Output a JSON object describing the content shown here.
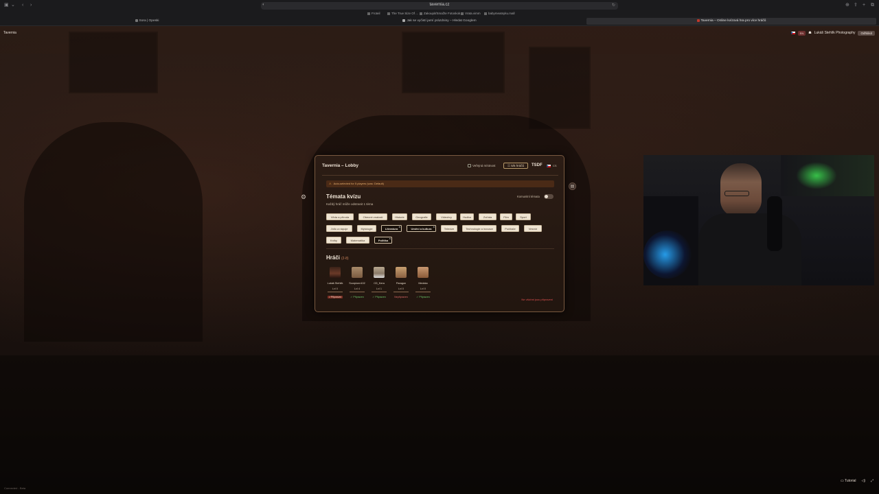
{
  "browser": {
    "url": "tavernia.cz",
    "bookmarks": [
      "Froteil",
      "The True Size Of ...",
      "Zakoupit/Smažte Fotoskok",
      "Vrata.vimm",
      "babymeatsyku.mall"
    ],
    "tabs": [
      {
        "label": "Sora | Opeski",
        "active": false
      },
      {
        "label": "Jak se vyčistí jarní prázdniny – Hledat Googlem",
        "active": false
      },
      {
        "label": "Tavernia – Online kvízová hra pro více hráčů",
        "active": true
      }
    ]
  },
  "site": {
    "name": "Tavernia",
    "lang": "EN",
    "user": "Lukáš Stehlík Photography",
    "logout": "Odhlásit"
  },
  "lobby": {
    "title": "Tavernia – Lobby",
    "public_room": "Veřejná místnost",
    "slots": "5/5 hráčů",
    "room_code": "TSDF",
    "room_lang": "CS",
    "alert": "Auto-selected for 5 players (was: Default)",
    "topics_title": "Témata kvízu",
    "topics_sub": "Každý hráč může odstranit 1 téma",
    "community_label": "Komunitní témata",
    "topics": [
      {
        "label": "Věda a příroda",
        "selected": false
      },
      {
        "label": "Obecné znalosti",
        "selected": false
      },
      {
        "label": "Historie",
        "selected": false
      },
      {
        "label": "Geografie",
        "selected": false
      },
      {
        "label": "Videohry",
        "selected": false
      },
      {
        "label": "Hudba",
        "selected": false
      },
      {
        "label": "Zvířata",
        "selected": false
      },
      {
        "label": "Film",
        "selected": false
      },
      {
        "label": "Sport",
        "selected": false
      },
      {
        "label": "Jídlo a nápoje",
        "selected": false
      },
      {
        "label": "Mytologie",
        "selected": false
      },
      {
        "label": "Literatura",
        "selected": true
      },
      {
        "label": "Umění a kultura",
        "selected": true
      },
      {
        "label": "Televize",
        "selected": false
      },
      {
        "label": "Technologie a inovace",
        "selected": false
      },
      {
        "label": "Počítače",
        "selected": false
      },
      {
        "label": "Vesmír",
        "selected": false
      },
      {
        "label": "Knihy",
        "selected": false
      },
      {
        "label": "Matematika",
        "selected": false
      },
      {
        "label": "Politika",
        "selected": true
      }
    ],
    "players_title": "Hráči",
    "players_range": "(2-8)",
    "players": [
      {
        "name": "Lukáš Stehlík",
        "level": "Lvl 0",
        "status": "Připraven",
        "ready": true,
        "is_button": true
      },
      {
        "name": "Scorpionn102",
        "level": "Lvl 4",
        "status": "Připraven",
        "ready": true,
        "is_button": false
      },
      {
        "name": "CD_Kera",
        "level": "Lvl 1",
        "status": "Připraven",
        "ready": true,
        "is_button": false
      },
      {
        "name": "Paragon",
        "level": "Lvl 0",
        "status": "Nepřipraven",
        "ready": false,
        "is_button": false
      },
      {
        "name": "Medzka",
        "level": "Lvl 0",
        "status": "Připraven",
        "ready": true,
        "is_button": false
      }
    ],
    "not_all_ready": "Ne všichni jsou připraveni"
  },
  "footer": {
    "connected": "Connected - Beta",
    "tutorial": "Tutorial"
  },
  "colors": {
    "accent": "#c8825a",
    "ready": "#6dcc6d",
    "not_ready": "#e05050",
    "chip_bg": "#efe4d2",
    "chip_selected_bg": "#1a120c"
  }
}
